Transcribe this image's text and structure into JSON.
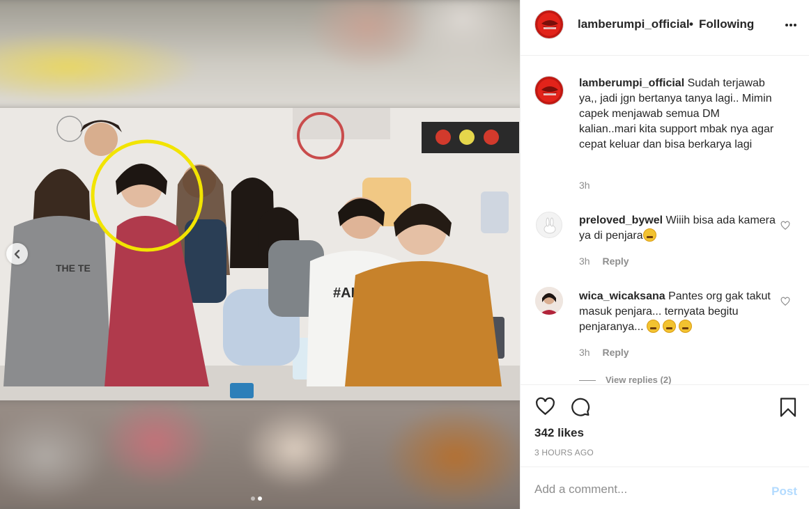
{
  "media": {
    "carousel_index": 2,
    "carousel_count": 2
  },
  "post": {
    "author": "lamberumpi_official",
    "separator": "•",
    "follow_status": "Following",
    "caption": "Sudah terjawab ya,, jadi jgn bertanya tanya lagi.. Mimin capek menjawab semua DM kalian..mari kita support mbak nya agar cepat keluar dan bisa berkarya lagi",
    "caption_time": "3h",
    "likes": "342 likes",
    "posted_ago": "3 HOURS AGO"
  },
  "comments": [
    {
      "user": "preloved_bywel",
      "text": "Wiiih bisa ada kamera ya di penjara",
      "emoji": [
        "grinning-face"
      ],
      "time": "3h",
      "reply_label": "Reply"
    },
    {
      "user": "wica_wicaksana",
      "text": "Pantes org gak takut masuk penjara... ternyata begitu penjaranya...",
      "emoji": [
        "laughing-face",
        "laughing-face",
        "laughing-face"
      ],
      "time": "3h",
      "reply_label": "Reply",
      "view_replies": "View replies (2)"
    }
  ],
  "add_comment": {
    "placeholder": "Add a comment...",
    "post_label": "Post"
  },
  "colors": {
    "text": "#262626",
    "muted": "#8e8e8e",
    "border": "#efefef",
    "post_disabled": "#b3dbff",
    "brand_red": "#e2231a",
    "highlight_circle": "#f2e400"
  },
  "icons": {
    "more": "more-horizontal-icon",
    "like": "heart-outline-icon",
    "comment": "speech-bubble-icon",
    "save": "bookmark-icon",
    "prev": "chevron-left-icon"
  }
}
